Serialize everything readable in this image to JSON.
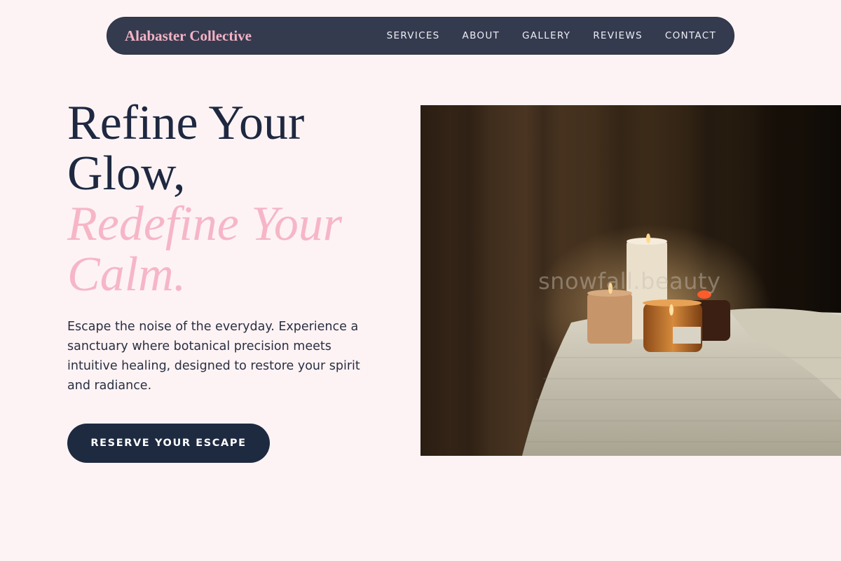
{
  "nav": {
    "brand": "Alabaster Collective",
    "items": [
      {
        "label": "SERVICES"
      },
      {
        "label": "ABOUT"
      },
      {
        "label": "GALLERY"
      },
      {
        "label": "REVIEWS"
      },
      {
        "label": "CONTACT"
      }
    ]
  },
  "hero": {
    "headline_line1": "Refine Your Glow,",
    "headline_accent": "Redefine Your Calm.",
    "lead": "Escape the noise of the everyday. Experience a sanctuary where botanical precision meets intuitive healing, designed to restore your spirit and radiance.",
    "cta_label": "RESERVE YOUR ESCAPE",
    "image_watermark": "snowfall.beauty"
  },
  "colors": {
    "background": "#fdf3f4",
    "nav_bg": "#353b4f",
    "brand_pink": "#f4b3c4",
    "navy": "#1e2a40",
    "accent_pink": "#f6b6c8"
  }
}
